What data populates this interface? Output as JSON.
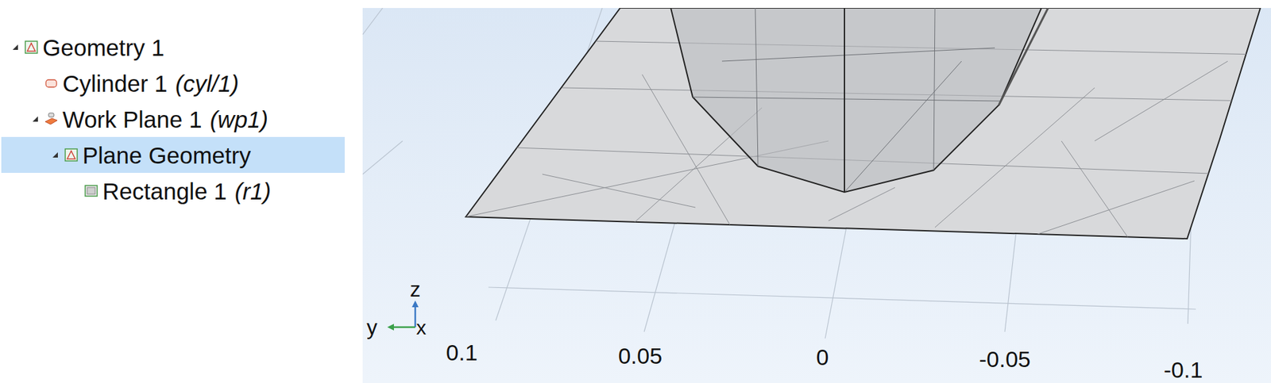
{
  "tree": {
    "items": [
      {
        "label": "Geometry 1",
        "tag": "",
        "level": 0,
        "kind": "geometry",
        "expanded": true,
        "selected": false
      },
      {
        "label": "Cylinder 1",
        "tag": "(cyl/1)",
        "level": 1,
        "kind": "cylinder",
        "expanded": false,
        "selected": false
      },
      {
        "label": "Work Plane 1",
        "tag": "(wp1)",
        "level": 1,
        "kind": "workplane",
        "expanded": true,
        "selected": false
      },
      {
        "label": "Plane Geometry",
        "tag": "",
        "level": 2,
        "kind": "geometry",
        "expanded": true,
        "selected": true
      },
      {
        "label": "Rectangle 1",
        "tag": "(r1)",
        "level": 3,
        "kind": "rectangle",
        "expanded": false,
        "selected": false
      }
    ]
  },
  "viewport": {
    "ticks": [
      "0.1",
      "0.05",
      "0",
      "-0.05",
      "-0.1"
    ],
    "triad": {
      "z": "z",
      "y": "y",
      "x": "x"
    }
  }
}
